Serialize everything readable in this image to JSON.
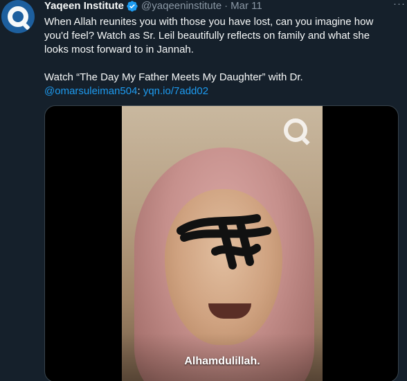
{
  "tweet": {
    "author_name": "Yaqeen Institute",
    "handle": "@yaqeeninstitute",
    "separator": "·",
    "date": "Mar 11",
    "more_label": "···",
    "text_line1": "When Allah reunites you with those you have lost, can you imagine how",
    "text_line2": "you'd feel? Watch as Sr. Leil beautifully reflects on family and what she",
    "text_line3": "looks most forward to in Jannah.",
    "watch_prefix": "Watch “The Day My Father Meets My Daughter” with Dr.",
    "mention": "@omarsuleiman504",
    "colon": ":",
    "link": "yqn.io/7add02"
  },
  "media": {
    "subtitle": "Alhamdulillah."
  },
  "colors": {
    "background": "#15202b",
    "link": "#1d9bf0",
    "secondary_text": "#8b98a5",
    "verified": "#1d9bf0"
  },
  "icons": {
    "avatar": "yaqeen-logo-icon",
    "verified": "verified-badge-icon",
    "more": "more-options-icon",
    "watermark": "yaqeen-watermark-icon"
  }
}
